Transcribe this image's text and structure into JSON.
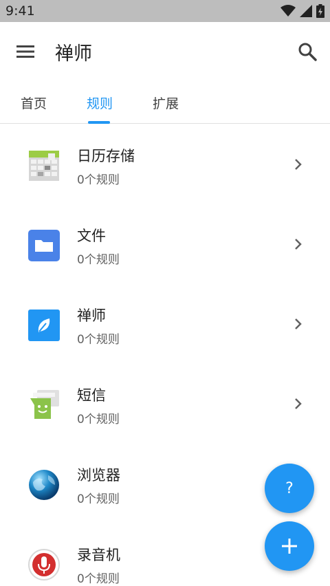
{
  "status_bar": {
    "time": "9:41"
  },
  "app_bar": {
    "title": "禅师"
  },
  "tabs": [
    {
      "label": "首页"
    },
    {
      "label": "规则"
    },
    {
      "label": "扩展"
    }
  ],
  "list": [
    {
      "title": "日历存储",
      "subtitle": "0个规则",
      "icon": "calendar-storage-icon"
    },
    {
      "title": "文件",
      "subtitle": "0个规则",
      "icon": "folder-icon"
    },
    {
      "title": "禅师",
      "subtitle": "0个规则",
      "icon": "leaf-icon"
    },
    {
      "title": "短信",
      "subtitle": "0个规则",
      "icon": "sms-icon"
    },
    {
      "title": "浏览器",
      "subtitle": "0个规则",
      "icon": "globe-icon"
    },
    {
      "title": "录音机",
      "subtitle": "0个规则",
      "icon": "microphone-icon"
    }
  ],
  "fab": {
    "help_label": "?"
  },
  "colors": {
    "accent": "#2196f3",
    "status_bar": "#bdbdbd"
  }
}
